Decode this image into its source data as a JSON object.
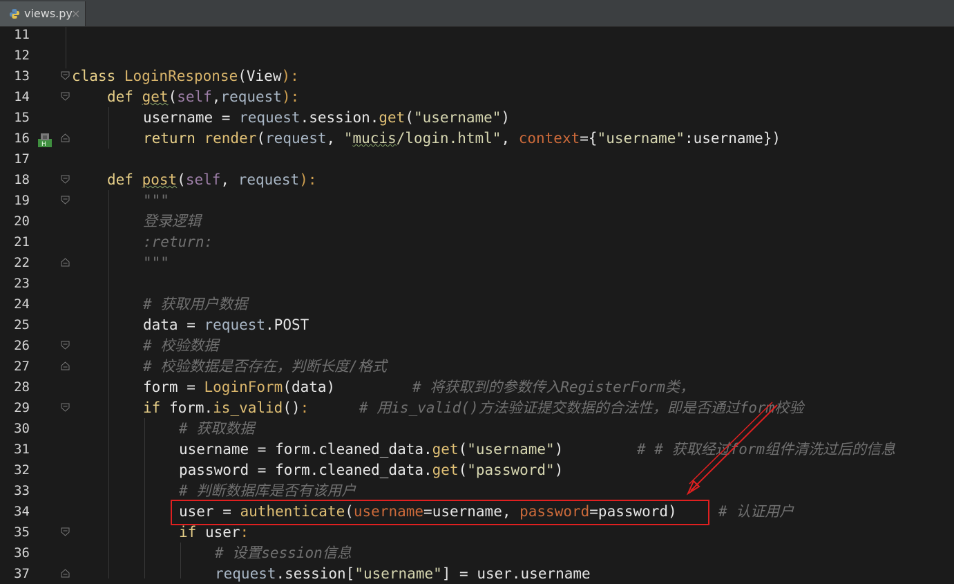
{
  "tab": {
    "filename": "views.py",
    "close": "×",
    "icon": "python-icon"
  },
  "gutter": {
    "line_numbers": [
      "11",
      "12",
      "13",
      "14",
      "15",
      "16",
      "17",
      "18",
      "19",
      "20",
      "21",
      "22",
      "23",
      "24",
      "25",
      "26",
      "27",
      "28",
      "29",
      "30",
      "31",
      "32",
      "33",
      "34",
      "35",
      "36",
      "37"
    ],
    "marker_icon": "run-marker-icon",
    "marker_label": "H"
  },
  "code": {
    "l13": {
      "kw": "class",
      "name": " LoginResponse",
      "open": "(",
      "base": "View",
      "close": "):"
    },
    "l14": {
      "kw": "def",
      "name": "get",
      "open": "(",
      "self": "self",
      "comma": ",",
      "req": "request",
      "close": "):"
    },
    "l15": {
      "a": "username = ",
      "req": "request",
      "b": ".session.",
      "get": "get",
      "c": "(",
      "s": "\"username\"",
      "d": ")"
    },
    "l16": {
      "ret": "return",
      "rend": " render",
      "a": "(",
      "req": "request",
      "b": ", ",
      "s1": "\"",
      "s2": "mucis",
      "s3": "/login.html\"",
      "c": ", ",
      "ctx": "context",
      "d": "={",
      "s4": "\"username\"",
      "e": ":username})"
    },
    "l18": {
      "kw": "def",
      "name": "post",
      "open": "(",
      "self": "self",
      "comma": ", ",
      "req": "request",
      "close": "):"
    },
    "l19": "\"\"\"",
    "l20": "登录逻辑",
    "l21": ":return:",
    "l22": "\"\"\"",
    "l24": "# 获取用户数据",
    "l25": {
      "a": "data = ",
      "req": "request",
      "b": ".POST"
    },
    "l26": "# 校验数据",
    "l27": "# 校验数据是否存在，判断长度/格式",
    "l28": {
      "a": "form = ",
      "cls": "LoginForm",
      "b": "(data)",
      "cmt": "# 将获取到的参数传入RegisterForm类，"
    },
    "l29": {
      "kw": "if",
      "a": " form.",
      "fn": "is_valid",
      "b": "()",
      "c": ":",
      "cmt": "# 用is_valid()方法验证提交数据的合法性，即是否通过form校验"
    },
    "l30": "# 获取数据",
    "l31": {
      "a": "username = form.cleaned_data.",
      "get": "get",
      "b": "(",
      "s": "\"username\"",
      "c": ")",
      "cmt": "# # 获取经过form组件清洗过后的信息"
    },
    "l32": {
      "a": "password = form.cleaned_data.",
      "get": "get",
      "b": "(",
      "s": "\"password\"",
      "c": ")"
    },
    "l33": "# 判断数据库是否有该用户",
    "l34": {
      "a": "user = ",
      "fn": "authenticate",
      "b": "(",
      "k1": "username",
      "c": "=username, ",
      "k2": "password",
      "d": "=password)",
      "cmt": "# 认证用户"
    },
    "l35": {
      "kw": "if",
      "a": " user",
      "c": ":"
    },
    "l36": "# 设置session信息",
    "l37": {
      "req": "request",
      "a": ".session[",
      "s": "\"username\"",
      "b": "] = user.username"
    }
  },
  "annotation": {
    "box_color": "#e02020",
    "arrow_color": "#e02020"
  }
}
